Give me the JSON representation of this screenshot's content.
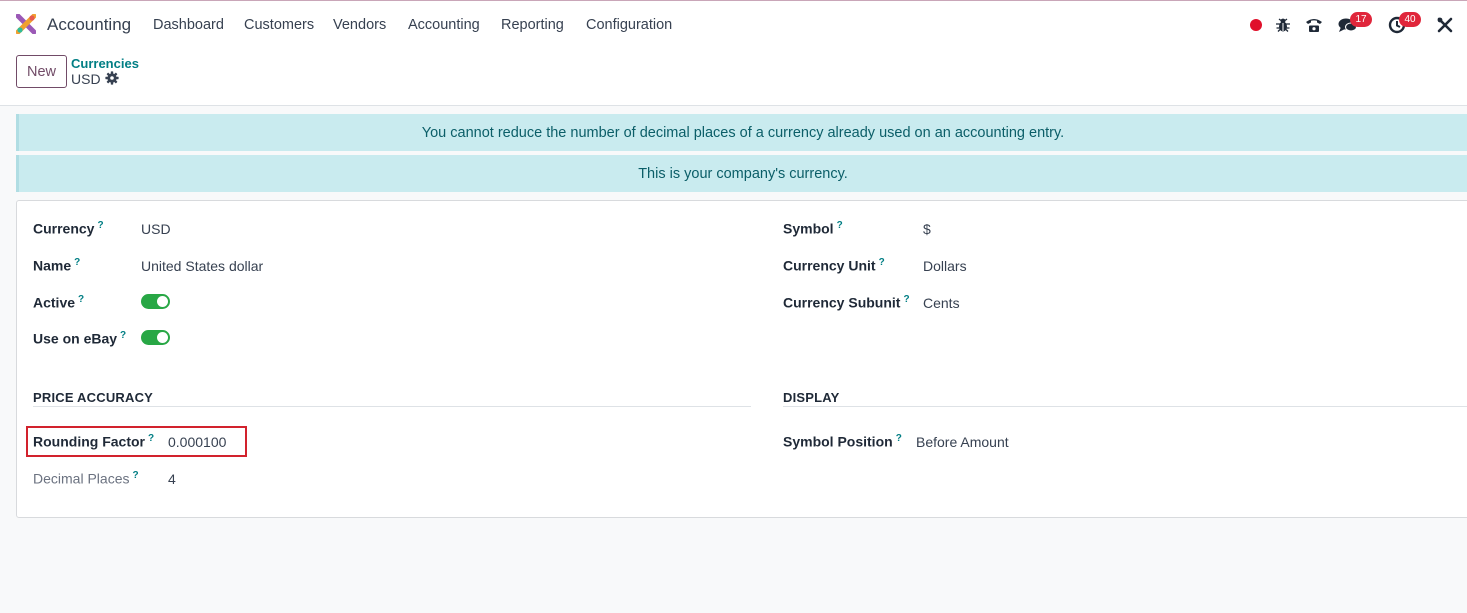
{
  "topbar": {
    "app_name": "Accounting",
    "menu": [
      "Dashboard",
      "Customers",
      "Vendors",
      "Accounting",
      "Reporting",
      "Configuration"
    ],
    "icons": [
      "status-dot-icon",
      "bug-icon",
      "phone-icon",
      "chat-icon",
      "activity-clock-icon",
      "tools-icon"
    ],
    "chat_badge": "17",
    "activity_badge": "40"
  },
  "control": {
    "new_label": "New",
    "breadcrumb_parent": "Currencies",
    "breadcrumb_current": "USD"
  },
  "alerts": {
    "decimal_warning": "You cannot reduce the number of decimal places of a currency already used on an accounting entry.",
    "company_currency": "This is your company's currency."
  },
  "form": {
    "help_mark": "?",
    "currency_label": "Currency",
    "currency_value": "USD",
    "name_label": "Name",
    "name_value": "United States dollar",
    "active_label": "Active",
    "ebay_label": "Use on eBay",
    "symbol_label": "Symbol",
    "symbol_value": "$",
    "unit_label": "Currency Unit",
    "unit_value": "Dollars",
    "subunit_label": "Currency Subunit",
    "subunit_value": "Cents",
    "price_accuracy_title": "PRICE ACCURACY",
    "display_title": "DISPLAY",
    "rounding_label": "Rounding Factor",
    "rounding_value": "0.000100",
    "decimal_label": "Decimal Places",
    "decimal_value": "4",
    "symbol_position_label": "Symbol Position",
    "symbol_position_value": "Before Amount"
  },
  "state": {
    "active": true,
    "use_on_ebay": true
  },
  "colors": {
    "brand": "#714b67",
    "link": "#017e84",
    "toggle_on": "#28a745",
    "alert_bg": "#c9ebef",
    "badge": "#e0263b",
    "highlight": "#d2222d"
  }
}
